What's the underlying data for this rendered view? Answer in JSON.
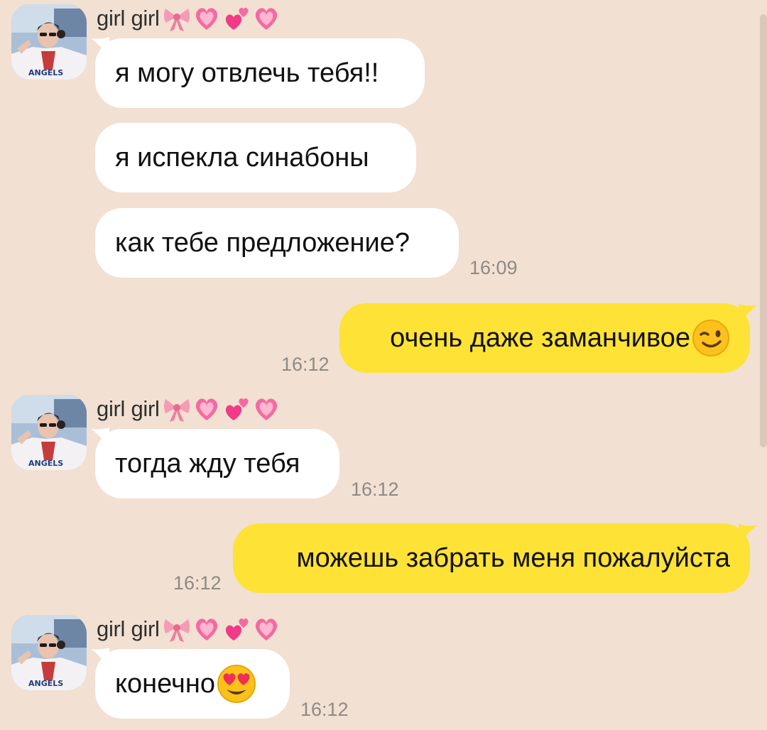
{
  "chat": {
    "sender_name": "girl girl",
    "sender_emoji": [
      "ribbon-emoji",
      "heart-emoji",
      "two-hearts-emoji",
      "heart-emoji"
    ],
    "messages": [
      {
        "dir": "in",
        "text": "я могу отвлечь тебя!!"
      },
      {
        "dir": "in",
        "text": "я испекла синабоны"
      },
      {
        "dir": "in",
        "text": "как тебе предложение?",
        "time": "16:09"
      },
      {
        "dir": "out",
        "text": "очень даже заманчивое",
        "emoji": "winking-face-emoji",
        "time": "16:12"
      },
      {
        "dir": "in",
        "text": "тогда жду тебя",
        "time": "16:12"
      },
      {
        "dir": "out",
        "text": "можешь забрать меня пожалуйста",
        "time": "16:12"
      },
      {
        "dir": "in",
        "text": "конечно",
        "emoji": "heart-eyes-emoji",
        "time": "16:12"
      }
    ]
  },
  "colors": {
    "background": "#f2e0d2",
    "incoming_bubble": "#ffffff",
    "outgoing_bubble": "#fee235",
    "timestamp": "#8e8a85"
  }
}
